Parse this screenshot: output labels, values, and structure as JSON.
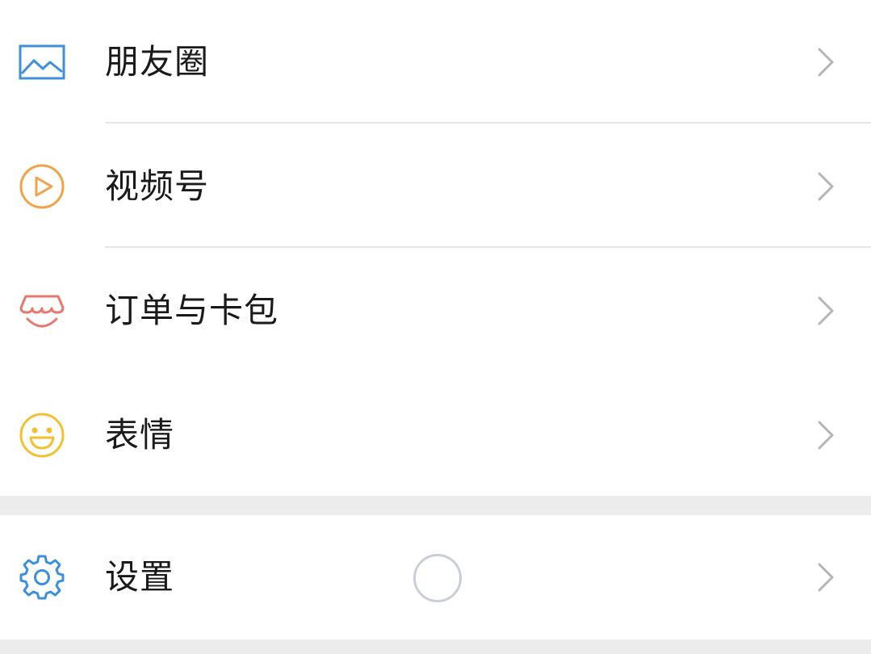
{
  "menu": {
    "items": [
      {
        "label": "朋友圈",
        "icon": "moments-icon",
        "color": "#3d8fe0"
      },
      {
        "label": "视频号",
        "icon": "channels-icon",
        "color": "#f0a348"
      },
      {
        "label": "订单与卡包",
        "icon": "orders-cards-icon",
        "color": "#e8796a"
      },
      {
        "label": "表情",
        "icon": "sticker-icon",
        "color": "#f3c130"
      }
    ],
    "settings": {
      "label": "设置",
      "icon": "gear-icon",
      "color": "#3d8fe0"
    }
  },
  "colors": {
    "background": "#ececec",
    "row_background": "#ffffff",
    "divider": "#e6e6e6",
    "chevron": "#b5b5b5",
    "text": "#1a1a1a"
  }
}
